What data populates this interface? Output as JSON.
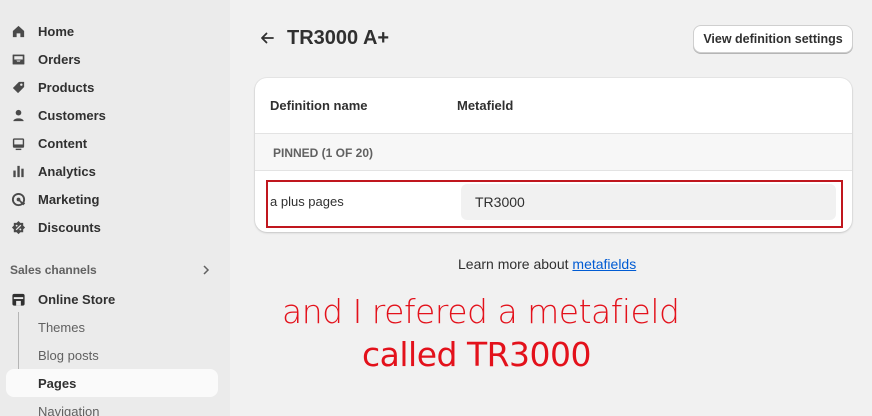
{
  "sidebar": {
    "items": [
      {
        "label": "Home",
        "icon": "home-icon"
      },
      {
        "label": "Orders",
        "icon": "inbox-icon"
      },
      {
        "label": "Products",
        "icon": "tag-icon"
      },
      {
        "label": "Customers",
        "icon": "person-icon"
      },
      {
        "label": "Content",
        "icon": "image-icon"
      },
      {
        "label": "Analytics",
        "icon": "bar-chart-icon"
      },
      {
        "label": "Marketing",
        "icon": "target-icon"
      },
      {
        "label": "Discounts",
        "icon": "discount-icon"
      }
    ],
    "sales_channels_label": "Sales channels",
    "online_store": {
      "label": "Online Store",
      "icon": "store-icon"
    },
    "sub_items": [
      {
        "label": "Themes"
      },
      {
        "label": "Blog posts"
      },
      {
        "label": "Pages",
        "active": true
      },
      {
        "label": "Navigation"
      }
    ]
  },
  "header": {
    "title": "TR3000 A+",
    "view_definition_button": "View definition settings"
  },
  "table": {
    "col_definition": "Definition name",
    "col_metafield": "Metafield",
    "pinned_label": "PINNED (1 OF 20)",
    "row": {
      "name": "a plus pages",
      "value": "TR3000"
    }
  },
  "footer": {
    "learn_more_prefix": "Learn more about ",
    "learn_more_link": "metafields"
  },
  "annotation": {
    "line1": "and I refered a metafield",
    "line2": "called TR3000",
    "color": "#e3111b"
  }
}
